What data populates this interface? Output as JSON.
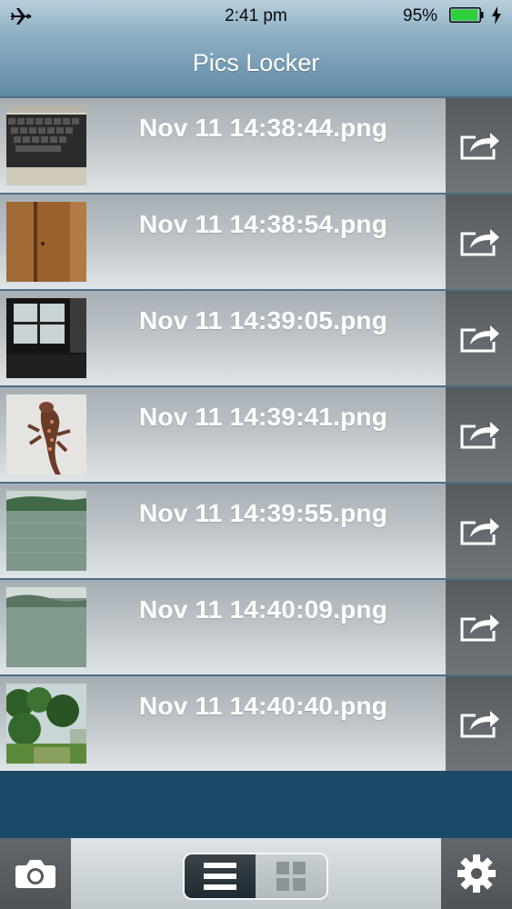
{
  "status_bar": {
    "airplane_icon": "airplane-icon",
    "time": "2:41 pm",
    "battery_percent": "95%",
    "battery_level": 0.95,
    "battery_color": "#2fd13a"
  },
  "header": {
    "title": "Pics Locker"
  },
  "files": [
    {
      "name": "Nov 11 14:38:44.png",
      "thumbnail": "keyboard-photo"
    },
    {
      "name": "Nov 11 14:38:54.png",
      "thumbnail": "wooden-door-photo"
    },
    {
      "name": "Nov 11 14:39:05.png",
      "thumbnail": "room-window-photo"
    },
    {
      "name": "Nov 11 14:39:41.png",
      "thumbnail": "lizard-photo"
    },
    {
      "name": "Nov 11 14:39:55.png",
      "thumbnail": "lake-photo"
    },
    {
      "name": "Nov 11 14:40:09.png",
      "thumbnail": "lake-hills-photo"
    },
    {
      "name": "Nov 11 14:40:40.png",
      "thumbnail": "garden-trees-photo"
    }
  ],
  "toolbar": {
    "camera_icon": "camera-icon",
    "list_view_icon": "list-view-icon",
    "grid_view_icon": "grid-view-icon",
    "settings_icon": "gear-icon",
    "selected_view": "list"
  }
}
